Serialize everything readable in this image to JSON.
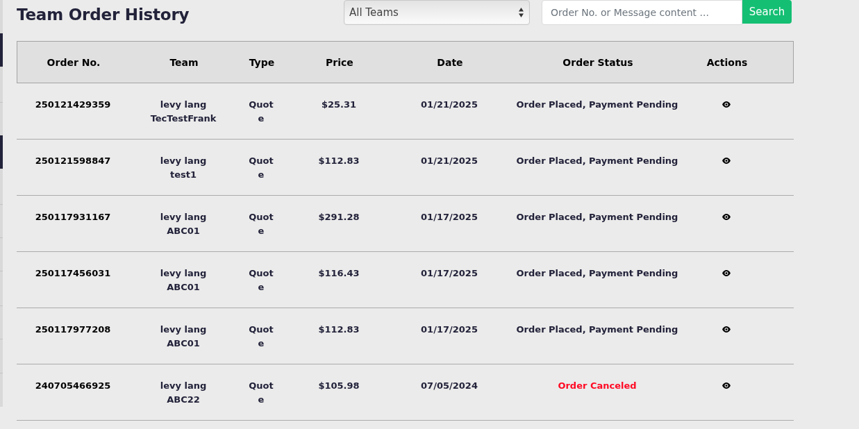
{
  "page": {
    "title": "Team Order History"
  },
  "filters": {
    "team_select": {
      "value": "All Teams"
    },
    "search": {
      "placeholder": "Order No. or Message content ...",
      "button": "Search"
    }
  },
  "table": {
    "columns": [
      "Order No.",
      "Team",
      "Type",
      "Price",
      "Date",
      "Order Status",
      "Actions"
    ],
    "rows": [
      {
        "order_no": "250121429359",
        "member": "levy lang",
        "team": "TecTestFrank",
        "type": "Quote",
        "price": "$25.31",
        "date": "01/21/2025",
        "status": {
          "text": "Order Placed, Payment Pending",
          "kind": "pending"
        }
      },
      {
        "order_no": "250121598847",
        "member": "levy lang",
        "team": "test1",
        "type": "Quote",
        "price": "$112.83",
        "date": "01/21/2025",
        "status": {
          "text": "Order Placed, Payment Pending",
          "kind": "pending"
        }
      },
      {
        "order_no": "250117931167",
        "member": "levy lang",
        "team": "ABC01",
        "type": "Quote",
        "price": "$291.28",
        "date": "01/17/2025",
        "status": {
          "text": "Order Placed, Payment Pending",
          "kind": "pending"
        }
      },
      {
        "order_no": "250117456031",
        "member": "levy lang",
        "team": "ABC01",
        "type": "Quote",
        "price": "$116.43",
        "date": "01/17/2025",
        "status": {
          "text": "Order Placed, Payment Pending",
          "kind": "pending"
        }
      },
      {
        "order_no": "250117977208",
        "member": "levy lang",
        "team": "ABC01",
        "type": "Quote",
        "price": "$112.83",
        "date": "01/17/2025",
        "status": {
          "text": "Order Placed, Payment Pending",
          "kind": "pending"
        }
      },
      {
        "order_no": "240705466925",
        "member": "levy lang",
        "team": "ABC22",
        "type": "Quote",
        "price": "$105.98",
        "date": "07/05/2024",
        "status": {
          "text": "Order Canceled",
          "kind": "canceled"
        }
      }
    ]
  }
}
